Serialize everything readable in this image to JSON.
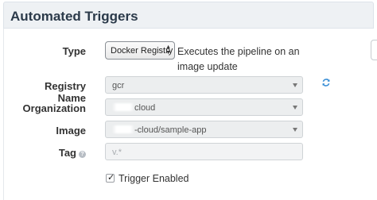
{
  "panel": {
    "title": "Automated Triggers"
  },
  "form": {
    "type": {
      "label": "Type",
      "selected": "Docker Registry",
      "description": "Executes the pipeline on an image update"
    },
    "registry_name": {
      "label": "Registry Name",
      "value": "gcr"
    },
    "organization": {
      "label": "Organization",
      "value_suffix": "cloud"
    },
    "image": {
      "label": "Image",
      "value_suffix": "-cloud/sample-app"
    },
    "tag": {
      "label": "Tag",
      "placeholder": "v.*"
    },
    "trigger_enabled": {
      "label": "Trigger Enabled",
      "checked": true
    }
  },
  "icons": {
    "refresh": "refresh-icon",
    "help": "help-icon",
    "caret": "chevron-down-icon",
    "select_arrows": "updown-arrows-icon"
  },
  "colors": {
    "header_bg": "#eef1f4",
    "field_bg": "#eceeef",
    "refresh_icon": "#3a8fd6"
  }
}
